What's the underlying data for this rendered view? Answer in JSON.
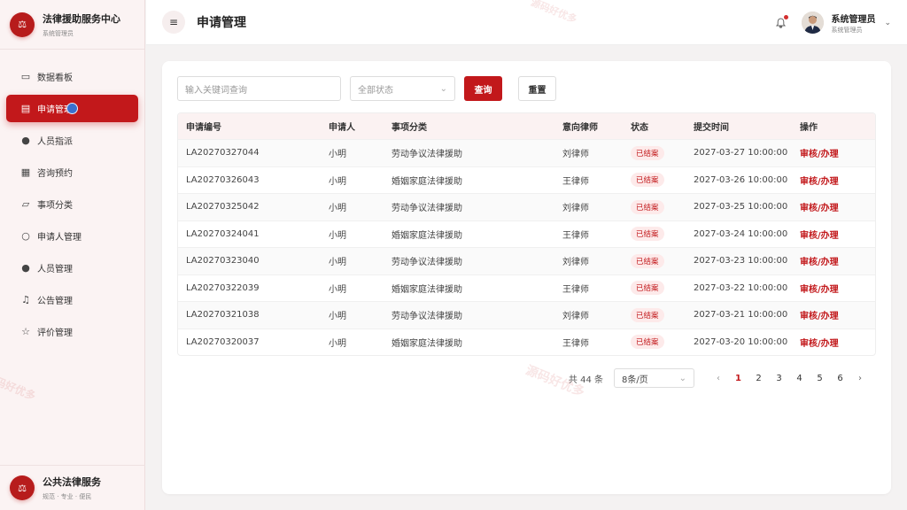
{
  "brand": {
    "title": "法律援助服务中心",
    "subtitle": "系统管理员",
    "logo_icon": "scales-icon"
  },
  "sidebar": {
    "items": [
      {
        "label": "数据看板",
        "icon": "monitor-icon",
        "glyph": "▭"
      },
      {
        "label": "申请管理",
        "icon": "document-icon",
        "glyph": "▤",
        "active": true
      },
      {
        "label": "人员指派",
        "icon": "user-icon",
        "glyph": "●"
      },
      {
        "label": "咨询预约",
        "icon": "calendar-icon",
        "glyph": "▦"
      },
      {
        "label": "事项分类",
        "icon": "folder-icon",
        "glyph": "▱"
      },
      {
        "label": "申请人管理",
        "icon": "user-outline-icon",
        "glyph": "○"
      },
      {
        "label": "人员管理",
        "icon": "user-icon",
        "glyph": "●"
      },
      {
        "label": "公告管理",
        "icon": "bell-icon",
        "glyph": "♫"
      },
      {
        "label": "评价管理",
        "icon": "star-icon",
        "glyph": "☆"
      }
    ]
  },
  "sidebar_footer": {
    "title": "公共法律服务",
    "subtitle": "规范 · 专业 · 便民"
  },
  "header": {
    "menu_icon": "≡",
    "title": "申请管理",
    "user_name": "系统管理员",
    "user_role": "系统管理员"
  },
  "filters": {
    "keyword_placeholder": "输入关键词查询",
    "status_placeholder": "全部状态",
    "search_label": "查询",
    "reset_label": "重置"
  },
  "table": {
    "columns": [
      "申请编号",
      "申请人",
      "事项分类",
      "意向律师",
      "状态",
      "提交时间",
      "操作"
    ],
    "rows": [
      {
        "id": "LA20270327044",
        "applicant": "小明",
        "category": "劳动争议法律援助",
        "lawyer": "刘律师",
        "status": "已结案",
        "time": "2027-03-27 10:00:00",
        "action": "审核/办理"
      },
      {
        "id": "LA20270326043",
        "applicant": "小明",
        "category": "婚姻家庭法律援助",
        "lawyer": "王律师",
        "status": "已结案",
        "time": "2027-03-26 10:00:00",
        "action": "审核/办理"
      },
      {
        "id": "LA20270325042",
        "applicant": "小明",
        "category": "劳动争议法律援助",
        "lawyer": "刘律师",
        "status": "已结案",
        "time": "2027-03-25 10:00:00",
        "action": "审核/办理"
      },
      {
        "id": "LA20270324041",
        "applicant": "小明",
        "category": "婚姻家庭法律援助",
        "lawyer": "王律师",
        "status": "已结案",
        "time": "2027-03-24 10:00:00",
        "action": "审核/办理"
      },
      {
        "id": "LA20270323040",
        "applicant": "小明",
        "category": "劳动争议法律援助",
        "lawyer": "刘律师",
        "status": "已结案",
        "time": "2027-03-23 10:00:00",
        "action": "审核/办理"
      },
      {
        "id": "LA20270322039",
        "applicant": "小明",
        "category": "婚姻家庭法律援助",
        "lawyer": "王律师",
        "status": "已结案",
        "time": "2027-03-22 10:00:00",
        "action": "审核/办理"
      },
      {
        "id": "LA20270321038",
        "applicant": "小明",
        "category": "劳动争议法律援助",
        "lawyer": "刘律师",
        "status": "已结案",
        "time": "2027-03-21 10:00:00",
        "action": "审核/办理"
      },
      {
        "id": "LA20270320037",
        "applicant": "小明",
        "category": "婚姻家庭法律援助",
        "lawyer": "王律师",
        "status": "已结案",
        "time": "2027-03-20 10:00:00",
        "action": "审核/办理"
      }
    ]
  },
  "pagination": {
    "total_text": "共 44 条",
    "page_size": "8条/页",
    "pages": [
      "1",
      "2",
      "3",
      "4",
      "5",
      "6"
    ],
    "current_page": "1"
  },
  "watermark": "源码好优多",
  "colors": {
    "accent": "#c2181b",
    "sidebar_bg": "#fbf3f3",
    "badge_bg": "#fdeaea"
  }
}
